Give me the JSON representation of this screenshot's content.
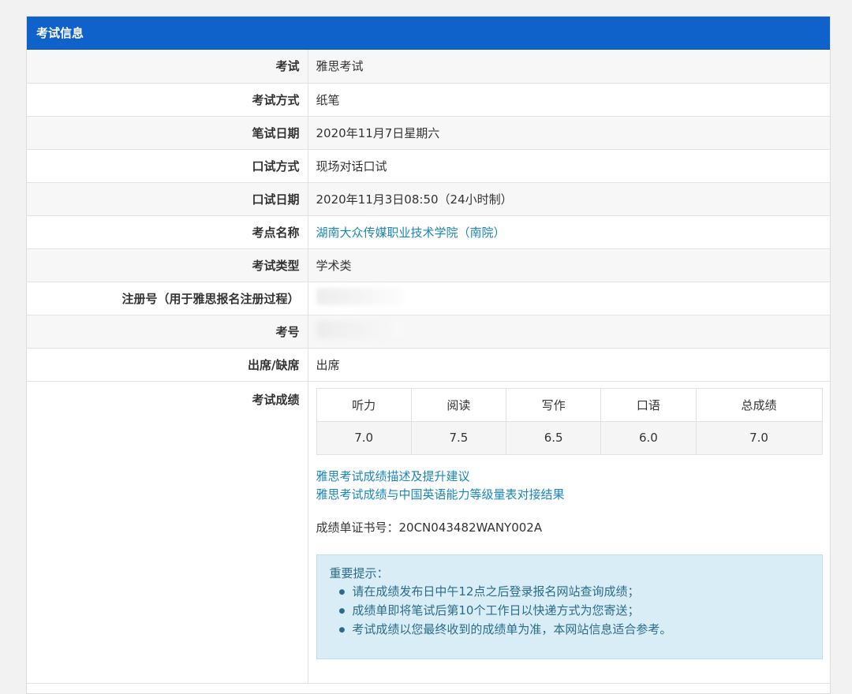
{
  "header": {
    "title": "考试信息"
  },
  "rows": [
    {
      "label": "考试",
      "value": "雅思考试"
    },
    {
      "label": "考试方式",
      "value": "纸笔"
    },
    {
      "label": "笔试日期",
      "value": "2020年11月7日星期六"
    },
    {
      "label": "口试方式",
      "value": "现场对话口试"
    },
    {
      "label": "口试日期",
      "value": "2020年11月3日08:50（24小时制）"
    },
    {
      "label": "考点名称",
      "value": "湖南大众传媒职业技术学院（南院）"
    },
    {
      "label": "考试类型",
      "value": "学术类"
    },
    {
      "label": "注册号（用于雅思报名注册过程）",
      "value": ""
    },
    {
      "label": "考号",
      "value": ""
    },
    {
      "label": "出席/缺席",
      "value": "出席"
    }
  ],
  "scores": {
    "label": "考试成绩",
    "columns": [
      "听力",
      "阅读",
      "写作",
      "口语",
      "总成绩"
    ],
    "values": [
      "7.0",
      "7.5",
      "6.5",
      "6.0",
      "7.0"
    ]
  },
  "links": [
    "雅思考试成绩描述及提升建议",
    "雅思考试成绩与中国英语能力等级量表对接结果"
  ],
  "certificate": "成绩单证书号：20CN043482WANY002A",
  "notice": {
    "title": "重要提示：",
    "items": [
      "请在成绩发布日中午12点之后登录报名网站查询成绩；",
      "成绩单即将笔试后第10个工作日以快递方式为您寄送；",
      "考试成绩以您最终收到的成绩单为准，本网站信息适合参考。"
    ]
  },
  "colors": {
    "header_bg": "#0f62c9",
    "link": "#1a86b8",
    "notice_bg": "#d9edf7"
  }
}
